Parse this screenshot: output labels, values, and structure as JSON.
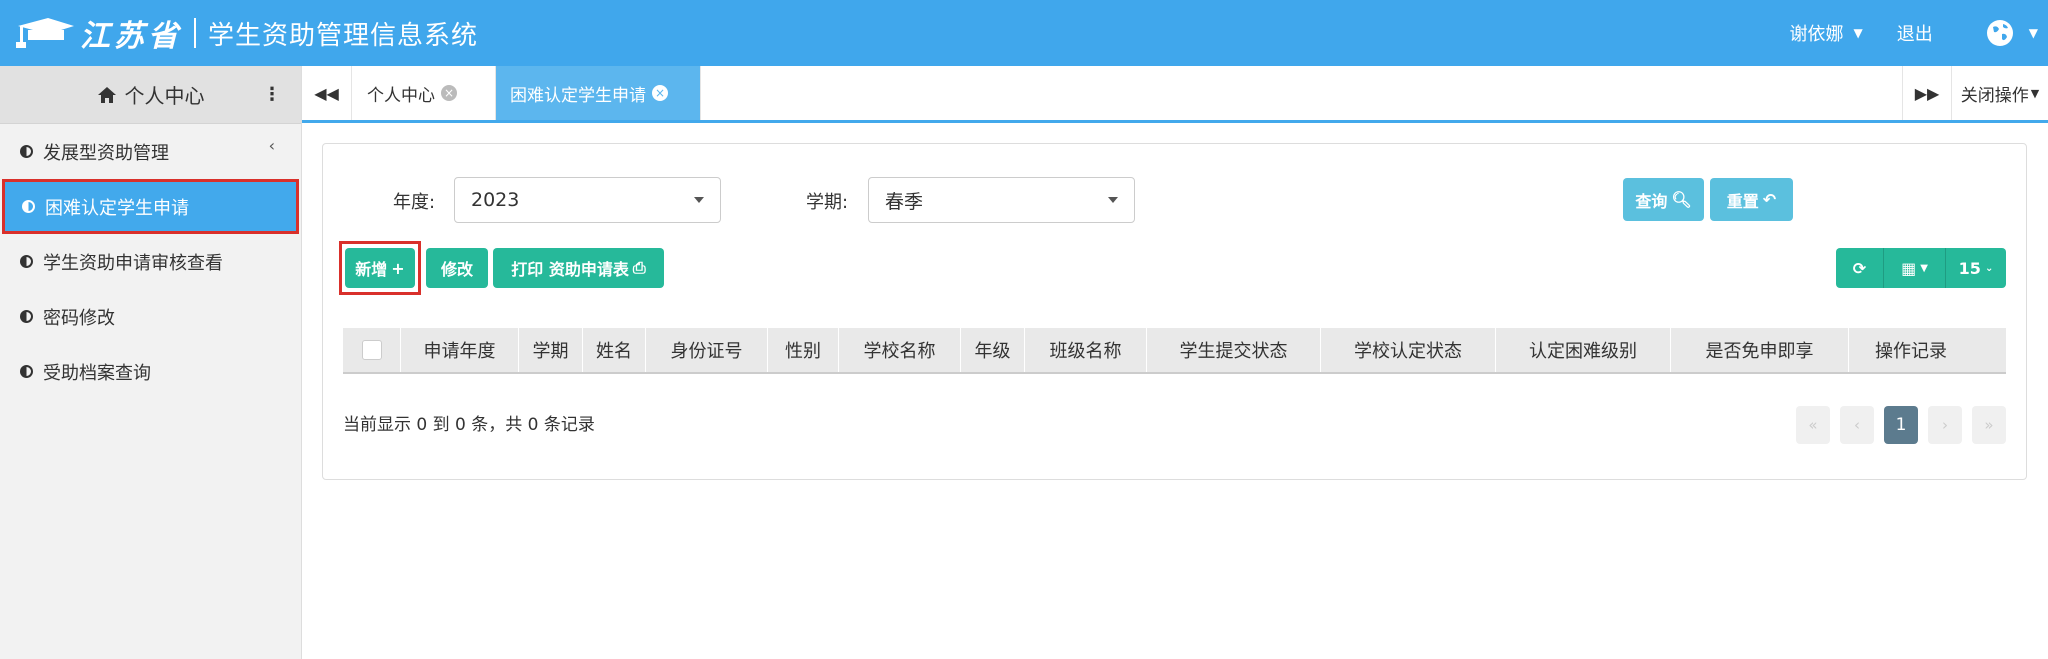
{
  "header": {
    "province": "江苏省",
    "system_name": "学生资助管理信息系统",
    "username": "谢依娜",
    "logout": "退出"
  },
  "sidebar": {
    "title": "个人中心",
    "items": [
      {
        "label": "发展型资助管理",
        "has_submenu": true
      },
      {
        "label": "困难认定学生申请",
        "active": true
      },
      {
        "label": "学生资助申请审核查看"
      },
      {
        "label": "密码修改"
      },
      {
        "label": "受助档案查询"
      }
    ]
  },
  "tabs": {
    "items": [
      {
        "label": "个人中心"
      },
      {
        "label": "困难认定学生申请",
        "active": true
      }
    ],
    "close_ops": "关闭操作"
  },
  "filters": {
    "year_label": "年度:",
    "year_value": "2023",
    "term_label": "学期:",
    "term_value": "春季",
    "query_button": "查询",
    "reset_button": "重置"
  },
  "toolbar": {
    "add_button": "新增",
    "edit_button": "修改",
    "print_button": "打印 资助申请表",
    "page_size": "15"
  },
  "table": {
    "columns": [
      "申请年度",
      "学期",
      "姓名",
      "身份证号",
      "性别",
      "学校名称",
      "年级",
      "班级名称",
      "学生提交状态",
      "学校认定状态",
      "认定困难级别",
      "是否免申即享",
      "操作记录"
    ]
  },
  "footer": {
    "summary": "当前显示 0 到 0 条，共 0 条记录",
    "current_page": "1"
  },
  "colors": {
    "header_blue": "#40a7ec",
    "success_green": "#26b99a",
    "info_blue": "#5bc0de",
    "highlight_red": "#d9302b"
  }
}
